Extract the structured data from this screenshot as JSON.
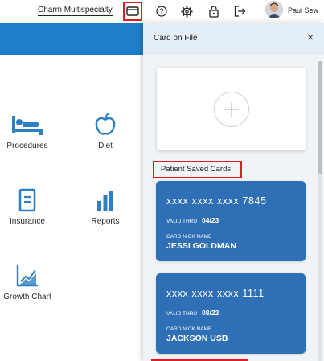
{
  "header": {
    "practice_name": "Charm Multispecialty",
    "user_name": "Paul Sew",
    "icons": [
      "card-on-file-icon",
      "help-icon",
      "settings-gear-icon",
      "lock-icon",
      "logout-icon"
    ]
  },
  "dashboard": {
    "tiles": [
      {
        "label": "Procedures",
        "icon": "procedures-icon"
      },
      {
        "label": "Diet",
        "icon": "apple-icon"
      },
      {
        "label": "Insurance",
        "icon": "document-icon"
      },
      {
        "label": "Reports",
        "icon": "bar-chart-icon"
      },
      {
        "label": "Growth Chart",
        "icon": "growth-chart-icon"
      }
    ]
  },
  "drawer": {
    "title": "Card on File",
    "close_symbol": "×",
    "saved_cards_label": "Patient Saved Cards",
    "cards": [
      {
        "number": "xxxx xxxx xxxx 7845",
        "valid_label": "VALID THRU",
        "valid_thru": "04/23",
        "nick_label": "CARD NICK NAME",
        "nick_name": "JESSI GOLDMAN"
      },
      {
        "number": "xxxx xxxx xxxx 1111",
        "valid_label": "VALID THRU",
        "valid_thru": "08/22",
        "nick_label": "CARD NICK NAME",
        "nick_name": "JACKSON USB"
      }
    ]
  },
  "colors": {
    "brand_blue": "#1f7ec8",
    "card_blue": "#2e6fb5",
    "highlight_red": "#e11b22",
    "icon_blue": "#2f7fc4"
  }
}
